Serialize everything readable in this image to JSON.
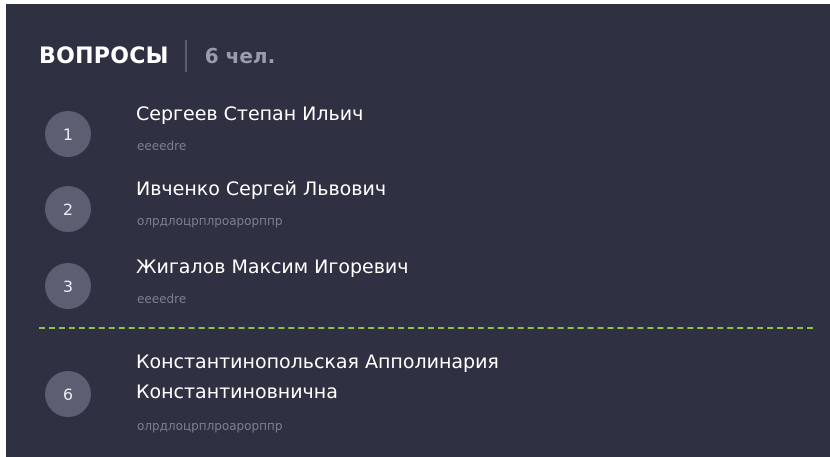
{
  "header": {
    "title": "ВОПРОСЫ",
    "count": "6 чел."
  },
  "items": [
    {
      "number": "1",
      "name": "Сергеев Степан Ильич",
      "subtitle": "eeeedre"
    },
    {
      "number": "2",
      "name": "Ивченко Сергей Львович",
      "subtitle": "олрдлоцрплроарорппр"
    },
    {
      "number": "3",
      "name": "Жигалов Максим Игоревич",
      "subtitle": "eeeedre"
    },
    {
      "number": "6",
      "name_line1": "Константинопольская Апполинария",
      "name_line2": "Константиновнична",
      "subtitle": "олрдлоцрплроарорппр"
    }
  ],
  "colors": {
    "background": "#2f3142",
    "circle": "#5c5f72",
    "divider": "#8bc34a",
    "muted_text": "#7d7f91"
  }
}
